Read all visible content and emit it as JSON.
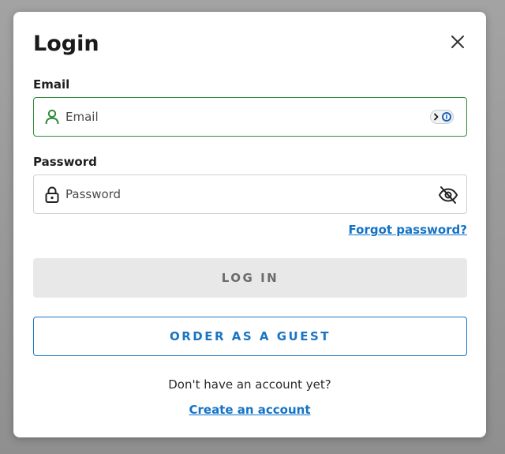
{
  "dialog": {
    "title": "Login",
    "close_icon": "close-icon"
  },
  "email": {
    "label": "Email",
    "placeholder": "Email",
    "value": "",
    "icon": "user-icon",
    "addon_icon": "password-manager-icon",
    "border_color": "#2f8a3a"
  },
  "password": {
    "label": "Password",
    "placeholder": "Password",
    "value": "",
    "icon": "lock-icon",
    "toggle_icon": "eye-off-icon"
  },
  "links": {
    "forgot_password": "Forgot password?",
    "create_account": "Create an account"
  },
  "buttons": {
    "login": "LOG IN",
    "guest": "ORDER AS A GUEST"
  },
  "footer": {
    "prompt": "Don't have an account yet?"
  },
  "colors": {
    "accent": "#1473c7",
    "success": "#2f8a3a",
    "disabled_bg": "#e8e8e9"
  }
}
